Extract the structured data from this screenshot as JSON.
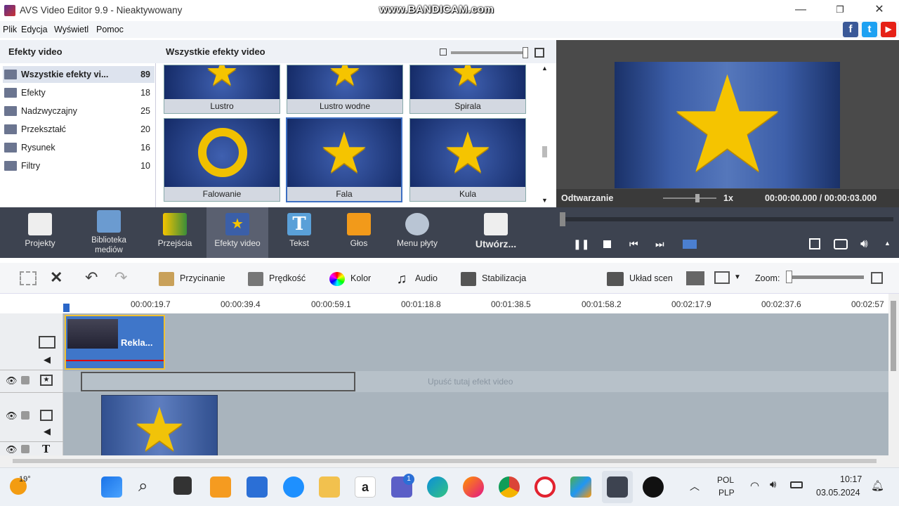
{
  "window": {
    "title": "AVS Video Editor 9.9 - Nieaktywowany",
    "watermark": "www.BANDICAM.com"
  },
  "menu": [
    "Plik",
    "Edycja",
    "Wyświetl",
    "Pomoc"
  ],
  "left_panel": {
    "header": "Efekty video",
    "categories": [
      {
        "label": "Wszystkie efekty vi...",
        "count": "89"
      },
      {
        "label": "Efekty",
        "count": "18"
      },
      {
        "label": "Nadzwyczajny",
        "count": "25"
      },
      {
        "label": "Przekształć",
        "count": "20"
      },
      {
        "label": "Rysunek",
        "count": "16"
      },
      {
        "label": "Filtry",
        "count": "10"
      }
    ]
  },
  "gallery": {
    "header": "Wszystkie efekty video",
    "row1": [
      "Lustro",
      "Lustro wodne",
      "Spirala"
    ],
    "row2": [
      "Falowanie",
      "Fala",
      "Kula"
    ]
  },
  "preview": {
    "label": "Odtwarzanie",
    "speed": "1x",
    "time": "00:00:00.000 / 00:00:03.000"
  },
  "toolbar": [
    {
      "label": "Projekty"
    },
    {
      "label": "Biblioteka mediów"
    },
    {
      "label": "Przejścia"
    },
    {
      "label": "Efekty video"
    },
    {
      "label": "Tekst"
    },
    {
      "label": "Głos"
    },
    {
      "label": "Menu płyty"
    },
    {
      "label": "Utwórz..."
    }
  ],
  "edit_tools": {
    "trim": "Przycinanie",
    "speed": "Prędkość",
    "color": "Kolor",
    "audio": "Audio",
    "stabilize": "Stabilizacja",
    "scene_layout": "Układ scen",
    "zoom": "Zoom:"
  },
  "ruler": [
    "00:00:19.7",
    "00:00:39.4",
    "00:00:59.1",
    "00:01:18.8",
    "00:01:38.5",
    "00:01:58.2",
    "00:02:17.9",
    "00:02:37.6",
    "00:02:57"
  ],
  "timeline": {
    "clip_label": "Rekla...",
    "drop_hint": "Upuść tutaj efekt video"
  },
  "taskbar": {
    "weather": "19°",
    "lang1": "POL",
    "lang2": "PLP",
    "time": "10:17",
    "date": "03.05.2024",
    "teams_badge": "1"
  }
}
